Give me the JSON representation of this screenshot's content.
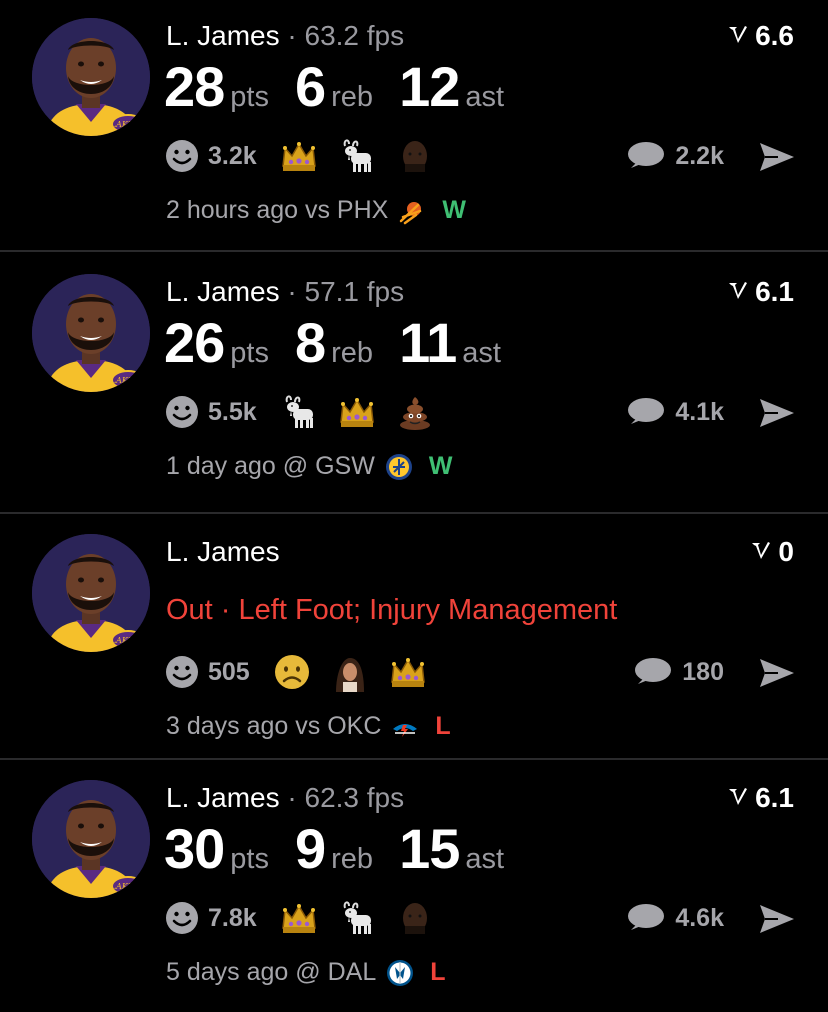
{
  "colors": {
    "win": "#3fbf73",
    "loss": "#f0433a",
    "muted": "#9a9aa0",
    "background": "#000000"
  },
  "cards": [
    {
      "player": "L. James",
      "fps": "63.2 fps",
      "score": "6.6",
      "stats": [
        {
          "value": "28",
          "unit": "pts"
        },
        {
          "value": "6",
          "unit": "reb"
        },
        {
          "value": "12",
          "unit": "ast"
        }
      ],
      "status": "",
      "reaction_count": "3.2k",
      "reaction_emojis": [
        "crown-icon",
        "goat-icon",
        "face-photo-icon"
      ],
      "comments": "2.2k",
      "time": "2 hours ago vs PHX",
      "opponent_logo": "suns-logo-icon",
      "result": "W"
    },
    {
      "player": "L. James",
      "fps": "57.1 fps",
      "score": "6.1",
      "stats": [
        {
          "value": "26",
          "unit": "pts"
        },
        {
          "value": "8",
          "unit": "reb"
        },
        {
          "value": "11",
          "unit": "ast"
        }
      ],
      "status": "",
      "reaction_count": "5.5k",
      "reaction_emojis": [
        "goat-icon",
        "crown-icon",
        "poop-icon"
      ],
      "comments": "4.1k",
      "time": "1 day ago @ GSW",
      "opponent_logo": "warriors-logo-icon",
      "result": "W"
    },
    {
      "player": "L. James",
      "fps": "",
      "score": "0",
      "stats": [],
      "status": "Out · Left Foot; Injury Management",
      "reaction_count": "505",
      "reaction_emojis": [
        "sad-face-icon",
        "person-photo-icon",
        "crown-icon"
      ],
      "comments": "180",
      "time": "3 days ago vs OKC",
      "opponent_logo": "thunder-logo-icon",
      "result": "L"
    },
    {
      "player": "L. James",
      "fps": "62.3 fps",
      "score": "6.1",
      "stats": [
        {
          "value": "30",
          "unit": "pts"
        },
        {
          "value": "9",
          "unit": "reb"
        },
        {
          "value": "15",
          "unit": "ast"
        }
      ],
      "status": "",
      "reaction_count": "7.8k",
      "reaction_emojis": [
        "crown-icon",
        "goat-icon",
        "face-photo-icon"
      ],
      "comments": "4.6k",
      "time": "5 days ago @ DAL",
      "opponent_logo": "mavericks-logo-icon",
      "result": "L"
    }
  ]
}
